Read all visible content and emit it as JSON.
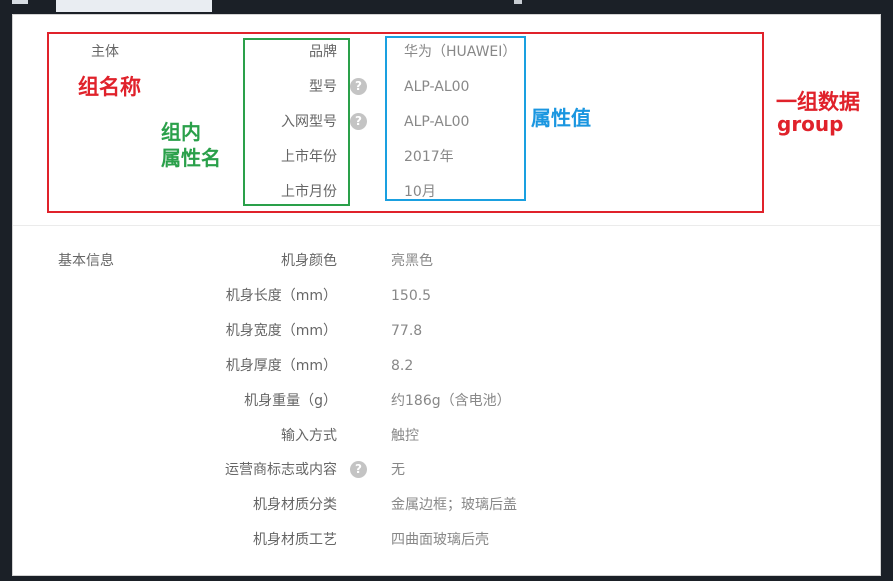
{
  "topbar": {
    "icon": "menu-icon"
  },
  "group1": {
    "name": "主体",
    "rows": [
      {
        "name": "品牌",
        "value": "华为（HUAWEI）",
        "help": false
      },
      {
        "name": "型号",
        "value": "ALP-AL00",
        "help": true
      },
      {
        "name": "入网型号",
        "value": "ALP-AL00",
        "help": true
      },
      {
        "name": "上市年份",
        "value": "2017年",
        "help": false
      },
      {
        "name": "上市月份",
        "value": "10月",
        "help": false
      }
    ]
  },
  "group2": {
    "name": "基本信息",
    "rows": [
      {
        "name": "机身颜色",
        "value": "亮黑色",
        "help": false
      },
      {
        "name": "机身长度（mm）",
        "value": "150.5",
        "help": false
      },
      {
        "name": "机身宽度（mm）",
        "value": "77.8",
        "help": false
      },
      {
        "name": "机身厚度（mm）",
        "value": "8.2",
        "help": false
      },
      {
        "name": "机身重量（g）",
        "value": "约186g（含电池）",
        "help": false
      },
      {
        "name": "输入方式",
        "value": "触控",
        "help": false
      },
      {
        "name": "运营商标志或内容",
        "value": "无",
        "help": true
      },
      {
        "name": "机身材质分类",
        "value": "金属边框；玻璃后盖",
        "help": false
      },
      {
        "name": "机身材质工艺",
        "value": "四曲面玻璃后壳",
        "help": false
      }
    ]
  },
  "help_glyph": "?",
  "annotations": {
    "group_name": "组名称",
    "attr_name_line1": "组内",
    "attr_name_line2": "属性名",
    "attr_value": "属性值",
    "group_data_line1": "一组数据",
    "group_data_line2": "group"
  },
  "colors": {
    "red": "#e0222b",
    "green": "#2aa04a",
    "blue": "#1aa0e0"
  }
}
